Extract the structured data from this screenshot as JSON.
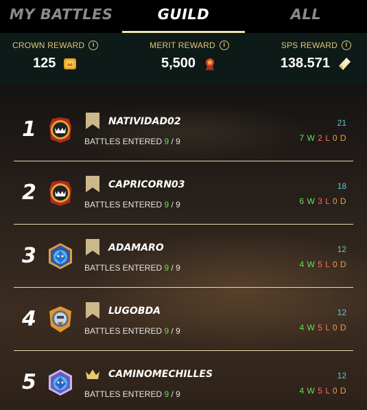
{
  "tabs": [
    {
      "label": "MY BATTLES",
      "active": false
    },
    {
      "label": "GUILD",
      "active": true
    },
    {
      "label": "ALL",
      "active": false
    }
  ],
  "rewards": [
    {
      "label": "CROWN REWARD",
      "value": "125",
      "icon": "crown-token-icon"
    },
    {
      "label": "MERIT REWARD",
      "value": "5,500",
      "icon": "merit-icon"
    },
    {
      "label": "SPS REWARD",
      "value": "138.571",
      "icon": "sps-crystal-icon"
    }
  ],
  "battles_label": "BATTLES ENTERED",
  "players": [
    {
      "rank": "1",
      "name": "NATIVIDAD02",
      "entered": "9",
      "total": "/ 9",
      "points": "21",
      "w": "7 W",
      "l": "2 L",
      "d": "0 D",
      "badge": "flag",
      "avatar": "monster-avatar"
    },
    {
      "rank": "2",
      "name": "CAPRICORN03",
      "entered": "9",
      "total": "/ 9",
      "points": "18",
      "w": "6 W",
      "l": "3 L",
      "d": "0 D",
      "badge": "flag",
      "avatar": "monster-avatar"
    },
    {
      "rank": "3",
      "name": "ADAMARO",
      "entered": "9",
      "total": "/ 9",
      "points": "12",
      "w": "4 W",
      "l": "5 L",
      "d": "0 D",
      "badge": "flag",
      "avatar": "blue-creature-avatar"
    },
    {
      "rank": "4",
      "name": "LUGOBDA",
      "entered": "9",
      "total": "/ 9",
      "points": "12",
      "w": "4 W",
      "l": "5 L",
      "d": "0 D",
      "badge": "flag",
      "avatar": "knight-avatar"
    },
    {
      "rank": "5",
      "name": "CAMINOMECHILLES",
      "entered": "9",
      "total": "/ 9",
      "points": "12",
      "w": "4 W",
      "l": "5 L",
      "d": "0 D",
      "badge": "crown",
      "avatar": "blue-creature-avatar"
    }
  ],
  "colors": {
    "gold": "#e3c77a",
    "win": "#5fe35a",
    "loss": "#ff6b6b",
    "draw": "#f2a33a",
    "points": "#5fc9d8"
  }
}
